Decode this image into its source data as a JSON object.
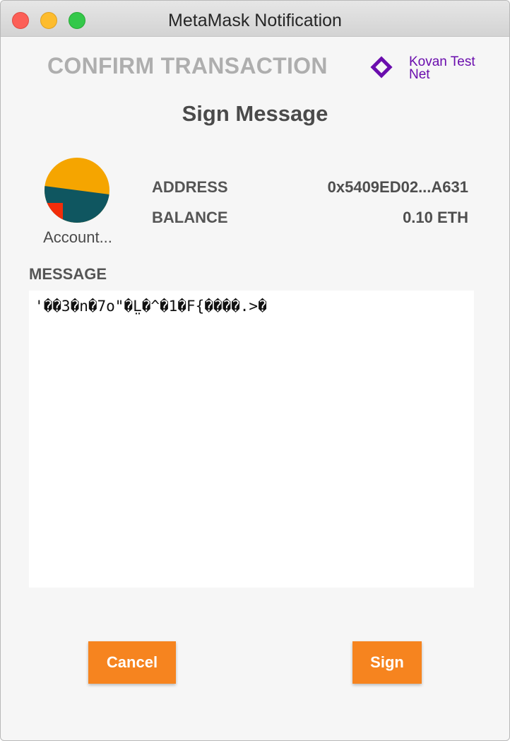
{
  "window": {
    "title": "MetaMask Notification"
  },
  "header": {
    "confirm_title": "CONFIRM TRANSACTION",
    "network_name": "Kovan Test Net",
    "network_icon": "kovan-diamond-icon",
    "network_color": "#6a0dad"
  },
  "page": {
    "title": "Sign Message"
  },
  "account": {
    "name": "Account...",
    "avatar_icon": "jazzicon-avatar",
    "address_label": "ADDRESS",
    "address_value": "0x5409ED02...A631",
    "balance_label": "BALANCE",
    "balance_value": "0.10 ETH"
  },
  "message": {
    "label": "MESSAGE",
    "content": "'��3�n�7o\"�L̤�^�1�F{����.>�"
  },
  "actions": {
    "cancel_label": "Cancel",
    "sign_label": "Sign",
    "accent_color": "#f6841f"
  }
}
